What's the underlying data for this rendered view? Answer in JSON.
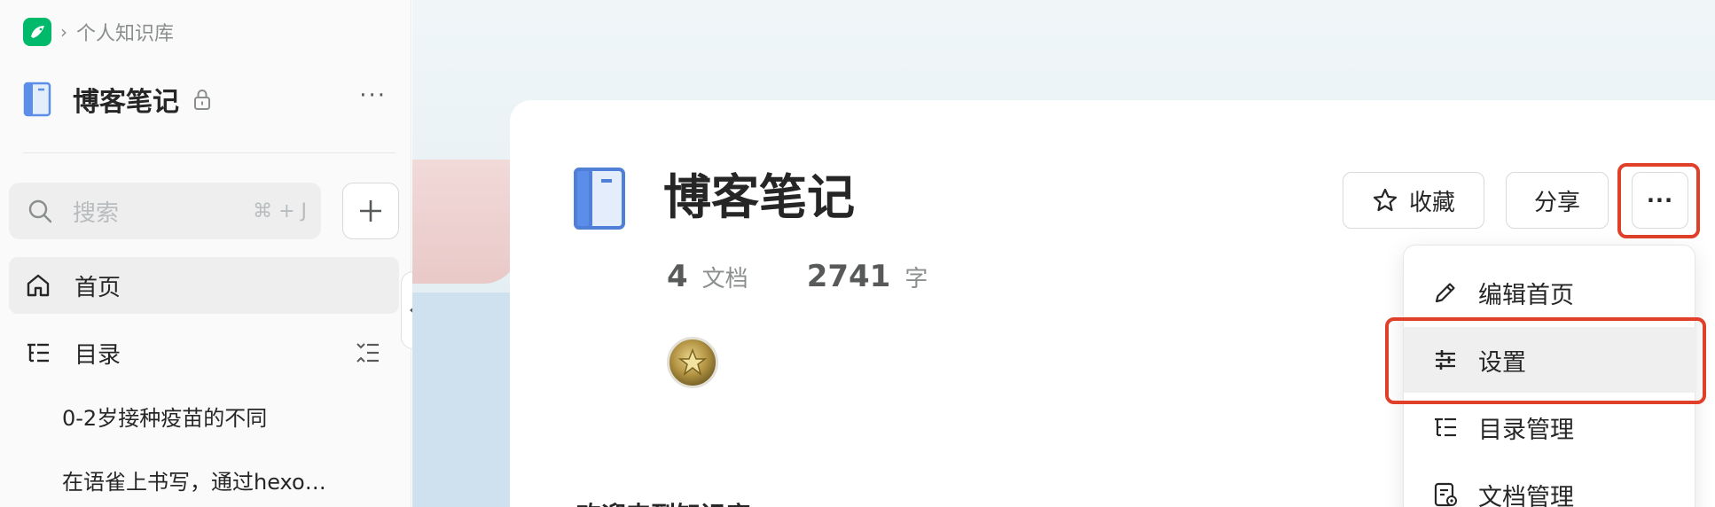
{
  "breadcrumb": {
    "current": "个人知识库"
  },
  "sidebar": {
    "title": "博客笔记",
    "more": "···",
    "search": {
      "placeholder": "搜索",
      "shortcut": "⌘ + J"
    },
    "nav": [
      {
        "label": "首页",
        "icon": "home-icon",
        "active": true
      },
      {
        "label": "目录",
        "icon": "toc-icon",
        "active": false
      }
    ],
    "docs": [
      "0-2岁接种疫苗的不同",
      "在语雀上书写，通过hexo…"
    ]
  },
  "main": {
    "title": "博客笔记",
    "stats": [
      {
        "value": "4",
        "label": "文档"
      },
      {
        "value": "2741",
        "label": "字"
      }
    ],
    "buttons": {
      "favorite": "收藏",
      "share": "分享",
      "more": "···"
    },
    "section_heading": "欢迎来到知识库"
  },
  "menu": {
    "items": [
      {
        "label": "编辑首页",
        "icon": "pencil-icon",
        "highlighted": false
      },
      {
        "label": "设置",
        "icon": "settings-sliders-icon",
        "highlighted": true
      },
      {
        "label": "目录管理",
        "icon": "toc-icon",
        "highlighted": false
      },
      {
        "label": "文档管理",
        "icon": "document-manage-icon",
        "highlighted": false
      }
    ]
  },
  "colors": {
    "accent_red": "#e0402a",
    "brand_green": "#00b96b",
    "book_blue": "#5a8ee8"
  }
}
